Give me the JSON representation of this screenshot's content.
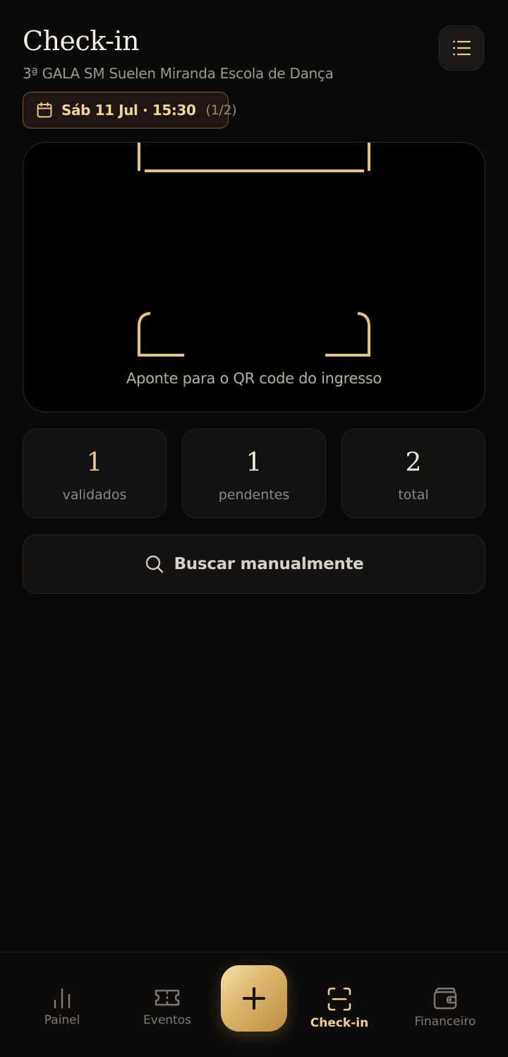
{
  "header": {
    "title": "Check-in",
    "subtitle": "3ª GALA SM  Suelen Miranda Escola de Dança"
  },
  "session": {
    "date_label": "Sáb 11 Jul · 15:30",
    "count_label": "(1/2)"
  },
  "scanner": {
    "hint": "Aponte para o QR code do ingresso"
  },
  "stats": [
    {
      "value": "1",
      "label": "validados"
    },
    {
      "value": "1",
      "label": "pendentes"
    },
    {
      "value": "2",
      "label": "total"
    }
  ],
  "search": {
    "label": "Buscar manualmente"
  },
  "nav": {
    "items": [
      {
        "label": "Painel",
        "icon": "bar-chart-icon"
      },
      {
        "label": "Eventos",
        "icon": "ticket-icon"
      },
      {
        "label": "Check-in",
        "icon": "scan-icon",
        "active": true
      },
      {
        "label": "Financeiro",
        "icon": "wallet-icon"
      }
    ],
    "fab_icon": "plus-icon"
  },
  "colors": {
    "background": "#0b0a0a",
    "accent_gold": "#e8c987",
    "chip_border": "#7a5a3a",
    "muted_text": "#8e877d"
  }
}
